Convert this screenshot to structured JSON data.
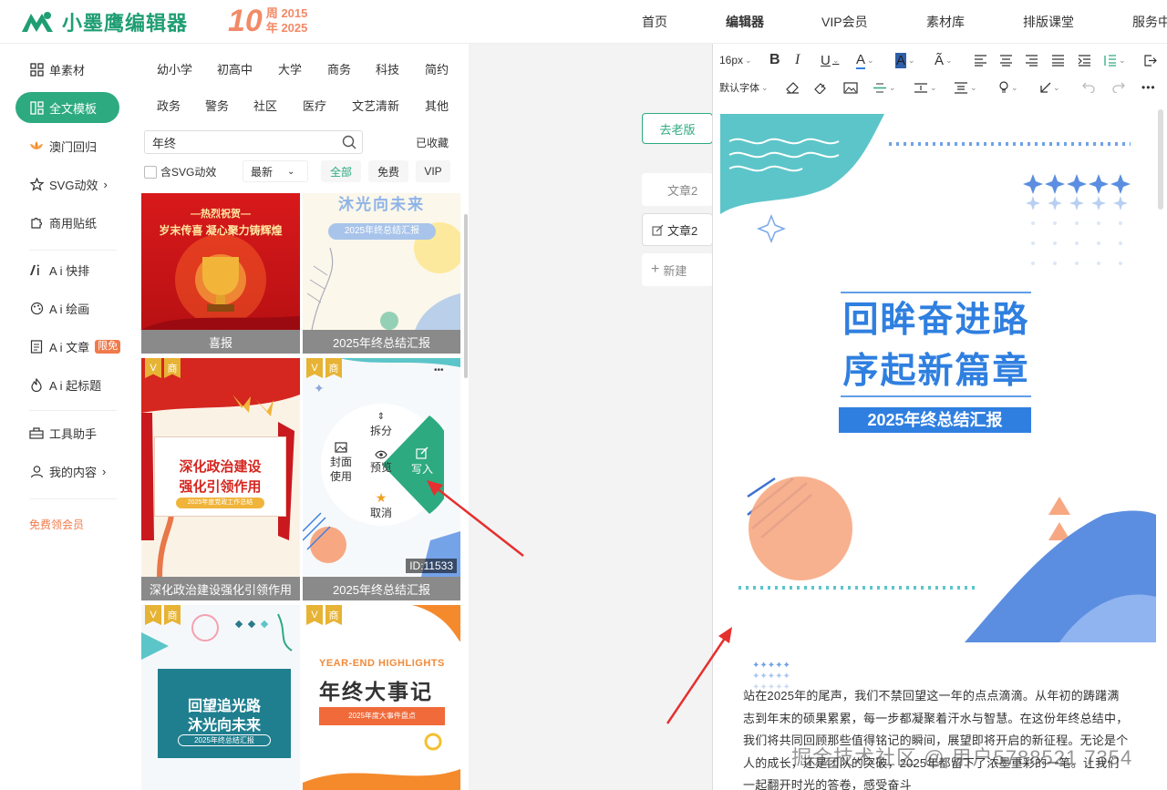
{
  "header": {
    "logo_text": "小墨鹰编辑器",
    "anniv_number": "10",
    "anniv_line1": "周 2015",
    "anniv_line2": "年 2025",
    "nav": [
      "首页",
      "编辑器",
      "VIP会员",
      "素材库",
      "排版课堂",
      "服务中"
    ]
  },
  "sidebar": {
    "items": [
      {
        "label": "单素材",
        "icon": "grid-icon"
      },
      {
        "label": "全文模板",
        "icon": "layout-icon"
      },
      {
        "label": "澳门回归",
        "icon": "lotus-icon"
      },
      {
        "label": "SVG动效",
        "icon": "star-outline-icon",
        "chevron": "›"
      },
      {
        "label": "商用贴纸",
        "icon": "puzzle-icon"
      },
      {
        "label": "A i 快排",
        "icon": "ai-icon"
      },
      {
        "label": "A i 绘画",
        "icon": "palette-icon"
      },
      {
        "label": "A i 文章",
        "icon": "document-icon",
        "badge": "限免"
      },
      {
        "label": "A i 起标题",
        "icon": "flame-icon"
      },
      {
        "label": "工具助手",
        "icon": "toolbox-icon"
      },
      {
        "label": "我的内容",
        "icon": "user-icon",
        "chevron": "›"
      }
    ],
    "free_vip": "免费领会员"
  },
  "panel": {
    "categories_row1": [
      "幼小学",
      "初高中",
      "大学",
      "商务",
      "科技",
      "简约"
    ],
    "categories_row2": [
      "政务",
      "警务",
      "社区",
      "医疗",
      "文艺清新",
      "其他"
    ],
    "search_value": "年终",
    "favorites": "已收藏",
    "svg_checkbox": "含SVG动效",
    "sort": "最新",
    "chips": [
      "全部",
      "免费",
      "VIP"
    ],
    "cards": [
      {
        "caption": "喜报",
        "line1": "—热烈祝贺—",
        "line2": "岁末传喜 凝心聚力铸辉煌"
      },
      {
        "caption": "2025年终总结汇报",
        "line1": "沐光向未来",
        "line2": "2025年终总结汇报"
      },
      {
        "caption": "深化政治建设强化引领作用",
        "line1": "深化政治建设",
        "line2": "强化引领作用",
        "line3": "2025年度党政工作总结"
      },
      {
        "caption": "2025年终总结汇报",
        "id": "ID:11533"
      },
      {
        "line1": "回望追光路",
        "line2": "沐光向未来",
        "line3": "2025年终总结汇报"
      },
      {
        "line1": "YEAR-END HIGHLIGHTS",
        "line2": "年终大事记",
        "line3": "2025年度大事件盘点"
      }
    ],
    "vip_tag": "V",
    "shang_tag": "商",
    "menu": {
      "split": "拆分",
      "cover": "封面",
      "cover2": "使用",
      "preview": "预览",
      "write": "写入",
      "cancel": "取消"
    },
    "more": "•••"
  },
  "middle": {
    "old_version": "去老版",
    "tab1": "文章2",
    "tab2": "文章2",
    "new": "新建"
  },
  "toolbar": {
    "font_size": "16px",
    "font_family": "默认字体"
  },
  "doc": {
    "title1": "回眸奋进路",
    "title2": "序起新篇章",
    "subtitle": "2025年终总结汇报",
    "paragraph": "站在2025年的尾声，我们不禁回望这一年的点点滴滴。从年初的踌躇满志到年末的硕果累累，每一步都凝聚着汗水与智慧。在这份年终总结中，我们将共同回顾那些值得铭记的瞬间，展望即将开启的新征程。无论是个人的成长，还是团队的突破，2025年都留下了浓墨重彩的一笔。让我们一起翻开时光的答卷，感受奋斗"
  },
  "watermark": "掘金技术社区 @ 用户5788521 7354",
  "colors": {
    "brand": "#2daa80",
    "accent_orange": "#f28a67",
    "title_blue": "#2f7fe0",
    "teal": "#5cc5c9"
  }
}
